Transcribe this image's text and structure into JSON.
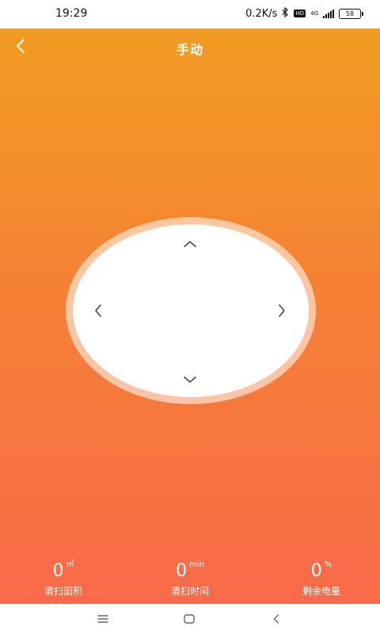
{
  "status_bar": {
    "time": "19:29",
    "network_speed": "0.2K/s",
    "hd_label": "HD",
    "network_type": "4G",
    "battery_level": "58"
  },
  "header": {
    "title": "手动",
    "back_icon": "chevron-left-icon"
  },
  "direction_pad": {
    "up_icon": "chevron-up-icon",
    "down_icon": "chevron-down-icon",
    "left_icon": "chevron-left-icon",
    "right_icon": "chevron-right-icon"
  },
  "stats": {
    "area": {
      "value": "0",
      "unit": "㎡",
      "label": "清扫面积"
    },
    "time": {
      "value": "0",
      "unit": "min",
      "label": "清扫时间"
    },
    "battery": {
      "value": "0",
      "unit": "%",
      "label": "剩余电量"
    }
  },
  "nav_bar": {
    "menu_icon": "menu-icon",
    "home_icon": "home-icon",
    "back_icon": "back-icon"
  },
  "colors": {
    "gradient_top": "#f19c21",
    "gradient_middle": "#f58135",
    "gradient_bottom": "#f96a4a",
    "dpad_background": "#ffffff",
    "text_on_accent": "#ffffff"
  }
}
